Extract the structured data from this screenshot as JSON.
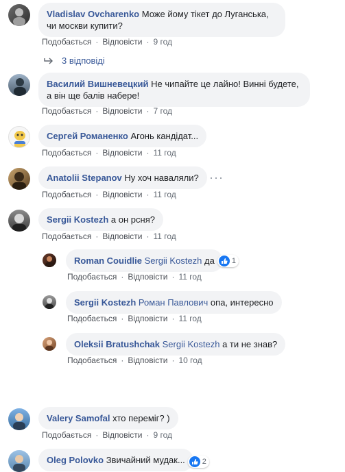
{
  "labels": {
    "like": "Подобається",
    "reply": "Відповісти",
    "sep": "·"
  },
  "comments": [
    {
      "author": "Vladislav Ovcharenko",
      "text": "Може йому тікет до Луганська, чи москви купити?",
      "time": "9 год"
    },
    {
      "author": "Василий Вишневецкий",
      "text": "Не чипайте це лайно! Винні будете, а він ще балів набере!",
      "time": "7 год"
    },
    {
      "author": "Сергей Романенко",
      "text": "Агонь кандідат...",
      "time": "11 год"
    },
    {
      "author": "Anatolii Stepanov",
      "text": "Ну хоч наваляли?",
      "time": "11 год"
    },
    {
      "author": "Sergii Kostezh",
      "text": "а он рсня?",
      "time": "11 год"
    },
    {
      "author": "Valery Samofal",
      "text": "хто переміг? )",
      "time": "9 год"
    },
    {
      "author": "Oleg Polovko",
      "text": "Звичайний мудак...",
      "reactions": "2"
    }
  ],
  "replies_link": "3 відповіді",
  "replies": [
    {
      "author": "Roman Couidlie",
      "mention": "Sergii Kostezh",
      "text": "да",
      "reactions": "1",
      "time": "11 год"
    },
    {
      "author": "Sergii Kostezh",
      "mention": "Роман Павлович",
      "text": "опа, интересно",
      "time": "11 год"
    },
    {
      "author": "Oleksii Bratushchak",
      "mention": "Sergii Kostezh",
      "text": "а ти не знав?",
      "time": "10 год"
    }
  ],
  "icons": {
    "reply_arrow": "reply-arrow-icon",
    "like": "like-icon",
    "more": "more-options-icon"
  },
  "colors": {
    "link": "#385898",
    "bubble": "#f2f3f5",
    "like": "#1877f2"
  }
}
